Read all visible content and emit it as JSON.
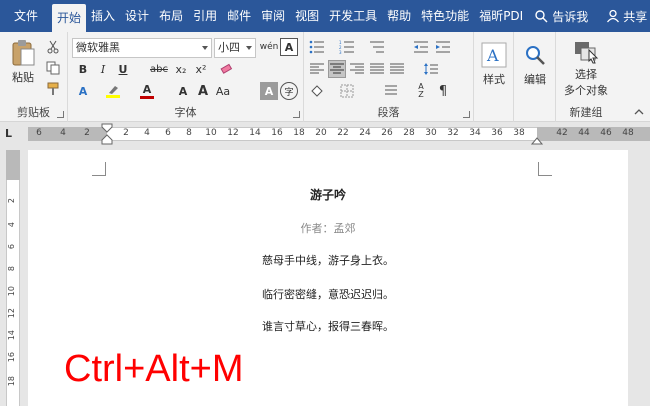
{
  "tabs": [
    "文件",
    "开始",
    "插入",
    "设计",
    "布局",
    "引用",
    "邮件",
    "审阅",
    "视图",
    "开发工具",
    "帮助",
    "特色功能",
    "福昕PDI"
  ],
  "active_tab_index": 1,
  "tell_me": "告诉我",
  "share": "共享",
  "clipboard": {
    "paste": "粘贴",
    "label": "剪贴板"
  },
  "font": {
    "name": "微软雅黑",
    "size": "小四",
    "label": "字体",
    "bold": "B",
    "italic": "I",
    "underline": "U",
    "strike": "abc",
    "sub": "x₂",
    "sup": "x²",
    "font_color": "#c00000",
    "highlight_color": "#ffff00"
  },
  "paragraph": {
    "label": "段落"
  },
  "styles": {
    "label": "样式"
  },
  "editing": {
    "label": "编辑"
  },
  "newgroup": {
    "select_line1": "选择",
    "select_line2": "多个对象",
    "label": "新建组"
  },
  "ruler": {
    "left_numbers": [
      "6",
      "4",
      "2"
    ],
    "right_numbers": [
      "2",
      "4",
      "6",
      "8",
      "10",
      "12",
      "14",
      "16",
      "18",
      "20",
      "22",
      "24",
      "26",
      "28",
      "30",
      "32",
      "34",
      "36",
      "38",
      "42",
      "44",
      "46",
      "48"
    ],
    "vertical_numbers": [
      "2",
      "4",
      "6",
      "8",
      "10",
      "12",
      "14",
      "16",
      "18"
    ]
  },
  "document": {
    "title": "游子吟",
    "author": "作者：孟郊",
    "lines": [
      "慈母手中线，游子身上衣。",
      "临行密密缝，意恐迟迟归。",
      "谁言寸草心，报得三春晖。"
    ]
  },
  "overlay": {
    "shortcut": "Ctrl+Alt+M",
    "color": "#ff0000"
  }
}
